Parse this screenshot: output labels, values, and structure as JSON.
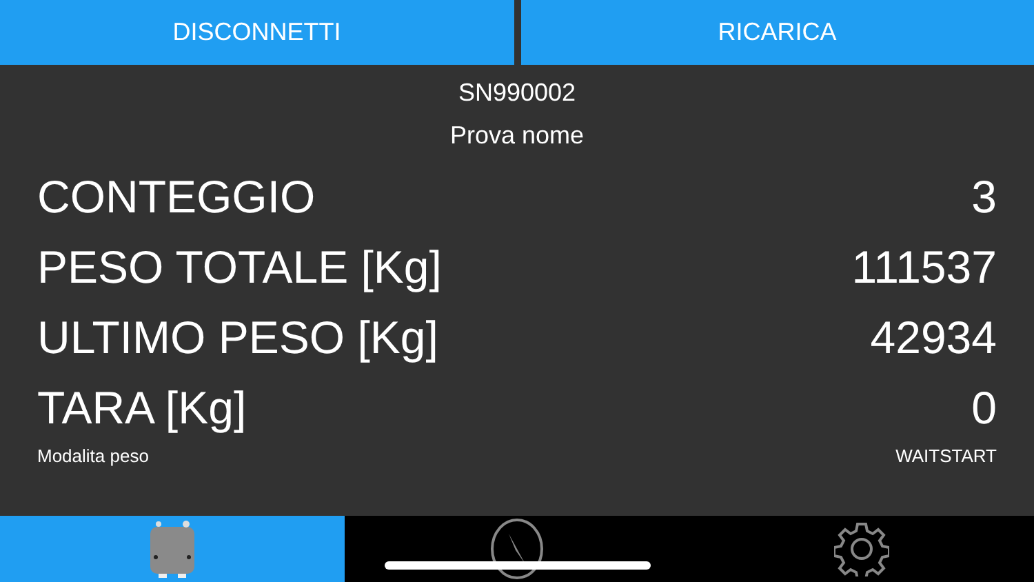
{
  "top_buttons": [
    "DISCONNETTI",
    "RICARICA"
  ],
  "device": {
    "serial": "SN990002",
    "name": "Prova nome"
  },
  "readings": [
    {
      "label": "CONTEGGIO",
      "value": "3"
    },
    {
      "label": "PESO TOTALE [Kg]",
      "value": "111537"
    },
    {
      "label": "ULTIMO PESO [Kg]",
      "value": "42934"
    },
    {
      "label": "TARA [Kg]",
      "value": "0"
    }
  ],
  "details": [
    {
      "label": "Modalita peso",
      "value": "WAITSTART"
    }
  ],
  "tab_bar": [
    {
      "kind": "device",
      "selected": true
    },
    {
      "kind": "compass",
      "selected": false
    },
    {
      "kind": "settings",
      "selected": false
    }
  ]
}
